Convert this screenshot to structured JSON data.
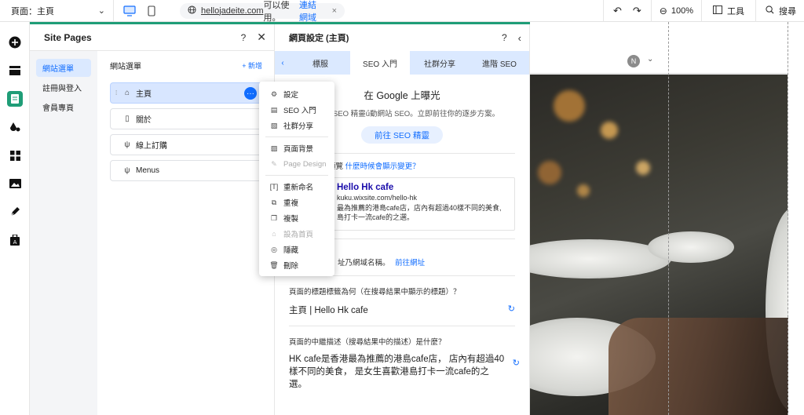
{
  "topbar": {
    "page_label": "頁面：主頁",
    "url_domain": "hellojadeite.com",
    "url_usable": "可以使用。",
    "url_connect": "連結網域",
    "zoom": "100%",
    "tools": "工具",
    "search": "搜尋"
  },
  "rail": {
    "items": [
      "add-icon",
      "sections-icon",
      "pages-icon",
      "theme-icon",
      "apps-icon",
      "media-icon",
      "blog-icon",
      "business-icon"
    ]
  },
  "pages_panel": {
    "title": "Site Pages",
    "nav": [
      "網站選單",
      "註冊與登入",
      "會員專頁"
    ],
    "content_title": "網站選單",
    "add_label": "+ 新增",
    "pages": [
      "主頁",
      "關於",
      "線上訂購",
      "Menus"
    ]
  },
  "context_menu": {
    "items": [
      {
        "label": "設定",
        "icon": "gear-icon",
        "disabled": false
      },
      {
        "label": "SEO 入門",
        "icon": "seo-icon",
        "disabled": false
      },
      {
        "label": "社群分享",
        "icon": "share-icon",
        "disabled": false
      },
      {
        "label": "頁面背景",
        "icon": "background-icon",
        "disabled": false
      },
      {
        "label": "Page Design",
        "icon": "brush-icon",
        "disabled": true
      },
      {
        "label": "重新命名",
        "icon": "rename-icon",
        "disabled": false
      },
      {
        "label": "重複",
        "icon": "duplicate-icon",
        "disabled": false
      },
      {
        "label": "複製",
        "icon": "copy-icon",
        "disabled": false
      },
      {
        "label": "設為首頁",
        "icon": "home-icon",
        "disabled": true
      },
      {
        "label": "隱藏",
        "icon": "hide-icon",
        "disabled": false
      },
      {
        "label": "刪除",
        "icon": "delete-icon",
        "disabled": false
      }
    ]
  },
  "settings": {
    "title": "網頁設定 (主頁)",
    "tabs": [
      "標服",
      "SEO 入門",
      "社群分享",
      "進階 SEO"
    ],
    "google_title": "在 Google 上曝光",
    "google_sub": "SEO 精靈ǘ動網站 SEO。立即前往你的逐步方案。",
    "seo_button": "前往 SEO 精靈",
    "preview_prefix": "預覽",
    "preview_link": "什麼時候會顯示變更？",
    "preview_title": "Hello Hk cafe",
    "preview_url": "kuku.wixsite.com/hello-hk",
    "preview_desc1": "最為推薦的港島cafe店，店內有超過40樣不同的美食,",
    "preview_desc2": "島打卡一流cafe的之選。",
    "domain_text": "址乃網域名稱。",
    "domain_link": "前往網址",
    "q1": "頁面的標題標籤為何（在搜尋結果中顯示的標題）？",
    "q1_value": "主頁 | Hello Hk cafe",
    "q2": "頁面的中繼描述（搜尋結果中的描述）是什麼？",
    "q2_value": "HK cafe是香港最為推薦的港島cafe店， 店內有超過40樣不同的美食， 是女生喜歡港島打卡一流cafe的之選。"
  },
  "canvas": {
    "avatar_initial": "N"
  },
  "colors": {
    "accent": "#116dff",
    "green_strip": "#1f9d77",
    "tab_bg": "#dbe9ff"
  }
}
